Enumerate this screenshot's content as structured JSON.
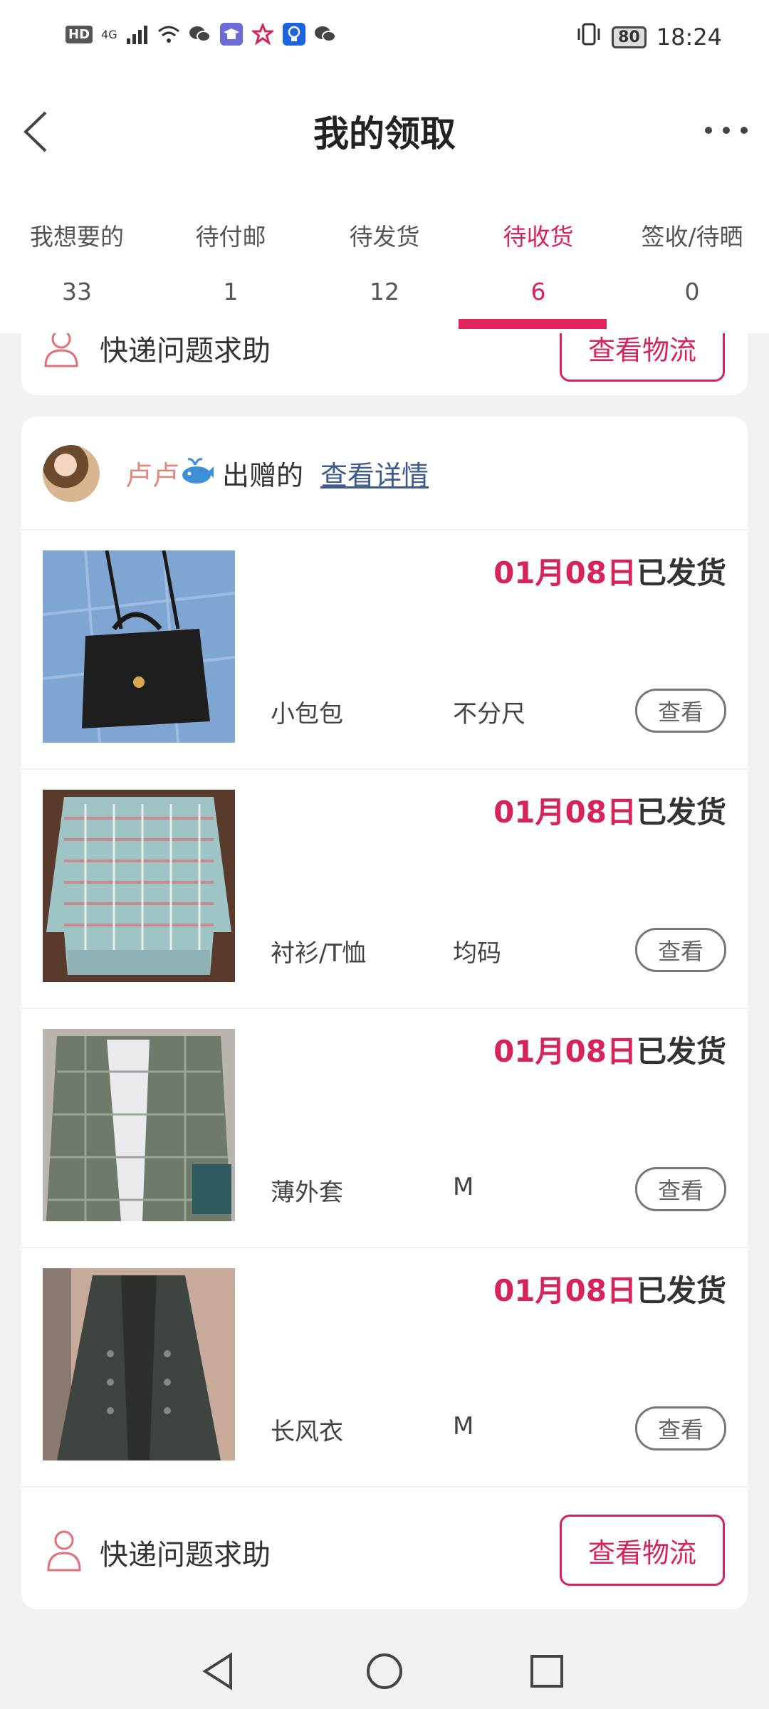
{
  "status_bar": {
    "hd": "HD",
    "network": "4G",
    "battery": "80",
    "time": "18:24",
    "icons": [
      "signal-icon",
      "wifi-icon",
      "wechat-icon",
      "grad-cap-icon",
      "star-icon",
      "bulb-icon",
      "wechat-icon",
      "vibrate-icon"
    ]
  },
  "header": {
    "title": "我的领取"
  },
  "tabs": [
    {
      "label": "我想要的",
      "count": "33"
    },
    {
      "label": "待付邮",
      "count": "1"
    },
    {
      "label": "待发货",
      "count": "12"
    },
    {
      "label": "待收货",
      "count": "6",
      "active": true
    },
    {
      "label": "签收/待晒",
      "count": "0"
    }
  ],
  "top_card": {
    "help_text": "快递问题求助",
    "logistics_button": "查看物流"
  },
  "order": {
    "giver_name": "卢卢",
    "action": "出赠的",
    "detail_link": "查看详情",
    "items": [
      {
        "date": "01月08日",
        "status": "已发货",
        "name": "小包包",
        "size": "不分尺",
        "view_label": "查看",
        "image": "handbag-photo"
      },
      {
        "date": "01月08日",
        "status": "已发货",
        "name": "衬衫/T恤",
        "size": "均码",
        "view_label": "查看",
        "image": "knit-top-photo"
      },
      {
        "date": "01月08日",
        "status": "已发货",
        "name": "薄外套",
        "size": "M",
        "view_label": "查看",
        "image": "blazer-photo"
      },
      {
        "date": "01月08日",
        "status": "已发货",
        "name": "长风衣",
        "size": "M",
        "view_label": "查看",
        "image": "trench-coat-photo"
      }
    ],
    "help_text": "快递问题求助",
    "logistics_button": "查看物流"
  },
  "colors": {
    "accent": "#d6245b",
    "link": "#3d5a8c",
    "giver": "#e4867b"
  }
}
